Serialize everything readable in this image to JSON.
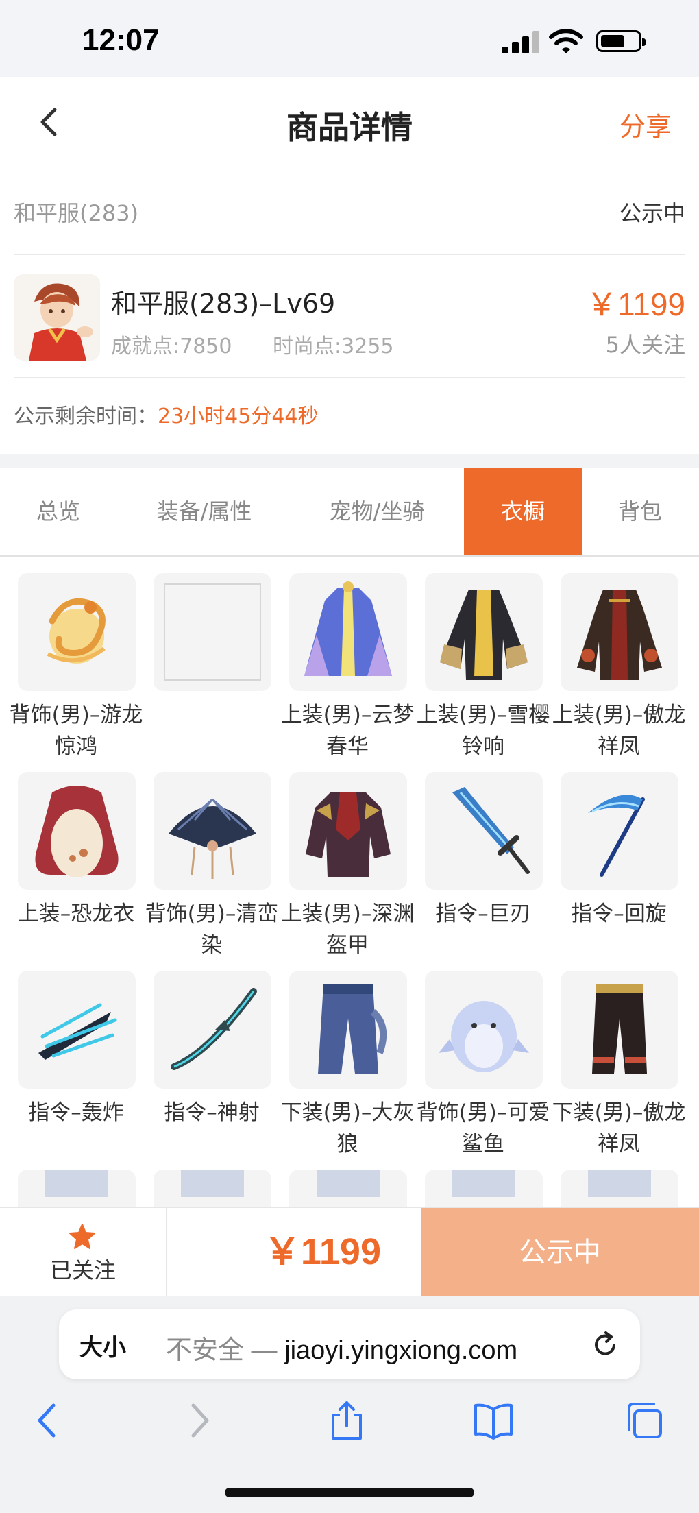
{
  "status_bar": {
    "time": "12:07"
  },
  "header": {
    "title": "商品详情",
    "share_label": "分享"
  },
  "info": {
    "server_name": "和平服(283)",
    "status": "公示中",
    "product_name": "和平服(283)–Lv69",
    "achievement_points": "成就点:7850",
    "fashion_points": "时尚点:3255",
    "price": "￥1199",
    "followers": "5人关注",
    "countdown_label": "公示剩余时间：",
    "countdown_value": "23小时45分44秒"
  },
  "tabs": [
    {
      "label": "总览",
      "active": false
    },
    {
      "label": "装备/属性",
      "active": false
    },
    {
      "label": "宠物/坐骑",
      "active": false
    },
    {
      "label": "衣橱",
      "active": true
    },
    {
      "label": "背包",
      "active": false
    }
  ],
  "wardrobe_items": [
    {
      "label": "背饰(男)–游龙惊鸿",
      "icon": "golden-dragon-icon"
    },
    {
      "label": "",
      "icon": "empty-slot-icon"
    },
    {
      "label": "上装(男)–云梦春华",
      "icon": "blue-robe-icon"
    },
    {
      "label": "上装(男)–雪樱铃响",
      "icon": "black-robe-icon"
    },
    {
      "label": "上装(男)–傲龙祥凤",
      "icon": "dark-robe-icon"
    },
    {
      "label": "上装–恐龙衣",
      "icon": "dinosaur-suit-icon"
    },
    {
      "label": "背饰(男)–清峦染",
      "icon": "fan-icon"
    },
    {
      "label": "上装(男)–深渊盔甲",
      "icon": "armor-icon"
    },
    {
      "label": "指令–巨刃",
      "icon": "sword-icon"
    },
    {
      "label": "指令–回旋",
      "icon": "scythe-icon"
    },
    {
      "label": "指令–轰炸",
      "icon": "claw-icon"
    },
    {
      "label": "指令–神射",
      "icon": "bow-icon"
    },
    {
      "label": "下装(男)–大灰狼",
      "icon": "wolf-pants-icon"
    },
    {
      "label": "背饰(男)–可爱鲨鱼",
      "icon": "shark-icon"
    },
    {
      "label": "下装(男)–傲龙祥凤",
      "icon": "black-pants-icon"
    },
    {
      "label": "",
      "icon": "partial-item-icon"
    },
    {
      "label": "",
      "icon": "partial-item-icon"
    },
    {
      "label": "",
      "icon": "partial-item-icon"
    },
    {
      "label": "",
      "icon": "partial-item-icon"
    },
    {
      "label": "",
      "icon": "partial-item-icon"
    }
  ],
  "action_bar": {
    "follow_label": "已关注",
    "price": "￥1199",
    "buy_label": "公示中"
  },
  "browser": {
    "text_size_label": "大小",
    "insecure_label": "不安全 — ",
    "url": "jiaoyi.yingxiong.com"
  },
  "colors": {
    "accent": "#ee6a2a",
    "button_disabled": "#f3b089",
    "ios_blue": "#3478f6"
  }
}
